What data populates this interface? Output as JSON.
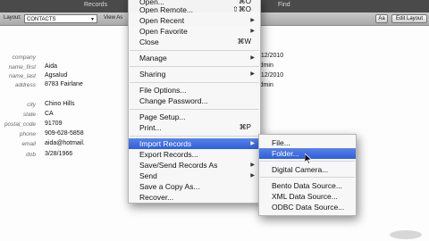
{
  "toolbar": {
    "top_labels": [
      "Records",
      "Find"
    ],
    "layout_label": "Layout:",
    "layout_value": "CONTACTS",
    "view_as_label": "View As",
    "right_buttons": [
      "Aa",
      "Edit Layout"
    ]
  },
  "record": {
    "fields": [
      {
        "label": "company",
        "value": ""
      },
      {
        "label": "name_first",
        "value": "Aida"
      },
      {
        "label": "name_last",
        "value": "Agsalud"
      },
      {
        "label": "address",
        "value": "8783 Fairlane"
      },
      {
        "label": "city",
        "value": "Chino Hills"
      },
      {
        "label": "state",
        "value": "CA"
      },
      {
        "label": "postal_code",
        "value": "91709"
      },
      {
        "label": "phone",
        "value": "909-628-5858"
      },
      {
        "label": "email",
        "value": "aida@hotmail."
      },
      {
        "label": "dob",
        "value": "3/28/1966"
      }
    ],
    "right_values": [
      "3/12/2010",
      "Admin",
      "3/12/2010",
      "Admin"
    ]
  },
  "file_menu": {
    "items": [
      {
        "label": "Open...",
        "shortcut": "⌘O",
        "submenu": false
      },
      {
        "label": "Open Remote...",
        "shortcut": "⇧⌘O",
        "submenu": false
      },
      {
        "label": "Open Recent",
        "shortcut": "",
        "submenu": true
      },
      {
        "label": "Open Favorite",
        "shortcut": "",
        "submenu": true
      },
      {
        "label": "Close",
        "shortcut": "⌘W",
        "submenu": false
      },
      {
        "label": "Manage",
        "shortcut": "",
        "submenu": true
      },
      {
        "label": "Sharing",
        "shortcut": "",
        "submenu": true
      },
      {
        "label": "File Options...",
        "shortcut": "",
        "submenu": false
      },
      {
        "label": "Change Password...",
        "shortcut": "",
        "submenu": false
      },
      {
        "label": "Page Setup...",
        "shortcut": "",
        "submenu": false
      },
      {
        "label": "Print...",
        "shortcut": "⌘P",
        "submenu": false
      },
      {
        "label": "Import Records",
        "shortcut": "",
        "submenu": true
      },
      {
        "label": "Export Records...",
        "shortcut": "",
        "submenu": false
      },
      {
        "label": "Save/Send Records As",
        "shortcut": "",
        "submenu": true
      },
      {
        "label": "Send",
        "shortcut": "",
        "submenu": true
      },
      {
        "label": "Save a Copy As...",
        "shortcut": "",
        "submenu": false
      },
      {
        "label": "Recover...",
        "shortcut": "",
        "submenu": false
      }
    ]
  },
  "import_submenu": {
    "items": [
      {
        "label": "File..."
      },
      {
        "label": "Folder..."
      },
      {
        "label": "Digital Camera..."
      },
      {
        "label": "Bento Data Source..."
      },
      {
        "label": "XML Data Source..."
      },
      {
        "label": "ODBC Data Source..."
      }
    ]
  },
  "colors": {
    "highlight": "#3a6ee0",
    "toolbar_dark": "#4a4a4a"
  },
  "icons": {
    "submenu_arrow": "▶"
  }
}
